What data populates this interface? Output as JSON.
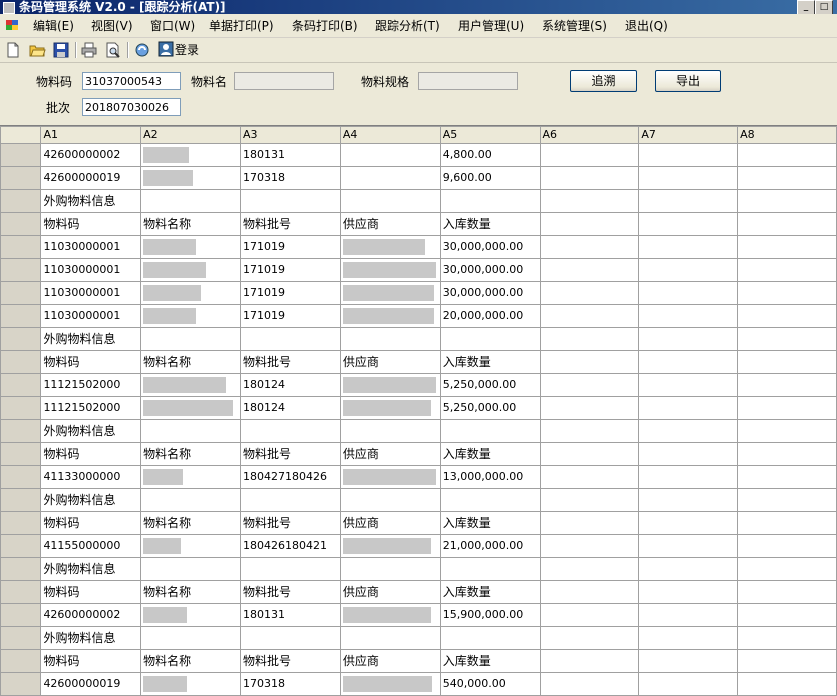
{
  "window": {
    "title": "条码管理系统 V2.0 - [跟踪分析(AT)]"
  },
  "menu": [
    "编辑(E)",
    "视图(V)",
    "窗口(W)",
    "单据打印(P)",
    "条码打印(B)",
    "跟踪分析(T)",
    "用户管理(U)",
    "系统管理(S)",
    "退出(Q)"
  ],
  "toolbar": {
    "login_label": "登录"
  },
  "form": {
    "material_code_label": "物料码",
    "material_code_value": "31037000543",
    "material_name_label": "物料名",
    "material_name_value": "",
    "material_spec_label": "物料规格",
    "material_spec_value": "",
    "batch_label": "批次",
    "batch_value": "201807030026",
    "trace_button": "追溯",
    "export_button": "导出"
  },
  "grid": {
    "columns": [
      "A1",
      "A2",
      "A3",
      "A4",
      "A5",
      "A6",
      "A7",
      "A8"
    ],
    "rows": [
      {
        "kind": "data",
        "a1": "42600000002",
        "a3": "180131",
        "a5": "4,800.00"
      },
      {
        "kind": "data",
        "a1": "42600000019",
        "a3": "170318",
        "a5": "9,600.00"
      },
      {
        "kind": "section",
        "a1": "外购物料信息"
      },
      {
        "kind": "header",
        "a1": "物料码",
        "a2": "物料名称",
        "a3": "物料批号",
        "a4": "供应商",
        "a5": "入库数量"
      },
      {
        "kind": "data",
        "a1": "11030000001",
        "a3": "171019",
        "a5": "30,000,000.00"
      },
      {
        "kind": "data",
        "a1": "11030000001",
        "a3": "171019",
        "a5": "30,000,000.00"
      },
      {
        "kind": "data",
        "a1": "11030000001",
        "a3": "171019",
        "a5": "30,000,000.00"
      },
      {
        "kind": "data",
        "a1": "11030000001",
        "a3": "171019",
        "a5": "20,000,000.00"
      },
      {
        "kind": "section",
        "a1": "外购物料信息"
      },
      {
        "kind": "header",
        "a1": "物料码",
        "a2": "物料名称",
        "a3": "物料批号",
        "a4": "供应商",
        "a5": "入库数量"
      },
      {
        "kind": "data",
        "a1": "11121502000",
        "a3": "180124",
        "a5": "5,250,000.00"
      },
      {
        "kind": "data",
        "a1": "11121502000",
        "a3": "180124",
        "a5": "5,250,000.00"
      },
      {
        "kind": "section",
        "a1": "外购物料信息"
      },
      {
        "kind": "header",
        "a1": "物料码",
        "a2": "物料名称",
        "a3": "物料批号",
        "a4": "供应商",
        "a5": "入库数量"
      },
      {
        "kind": "data",
        "a1": "41133000000",
        "a3": "180427180426",
        "a5": "13,000,000.00"
      },
      {
        "kind": "section",
        "a1": "外购物料信息"
      },
      {
        "kind": "header",
        "a1": "物料码",
        "a2": "物料名称",
        "a3": "物料批号",
        "a4": "供应商",
        "a5": "入库数量"
      },
      {
        "kind": "data",
        "a1": "41155000000",
        "a3": "180426180421",
        "a5": "21,000,000.00"
      },
      {
        "kind": "section",
        "a1": "外购物料信息"
      },
      {
        "kind": "header",
        "a1": "物料码",
        "a2": "物料名称",
        "a3": "物料批号",
        "a4": "供应商",
        "a5": "入库数量"
      },
      {
        "kind": "data",
        "a1": "42600000002",
        "a3": "180131",
        "a5": "15,900,000.00"
      },
      {
        "kind": "section",
        "a1": "外购物料信息"
      },
      {
        "kind": "header",
        "a1": "物料码",
        "a2": "物料名称",
        "a3": "物料批号",
        "a4": "供应商",
        "a5": "入库数量"
      },
      {
        "kind": "data",
        "a1": "42600000019",
        "a3": "170318",
        "a5": "540,000.00"
      }
    ]
  }
}
